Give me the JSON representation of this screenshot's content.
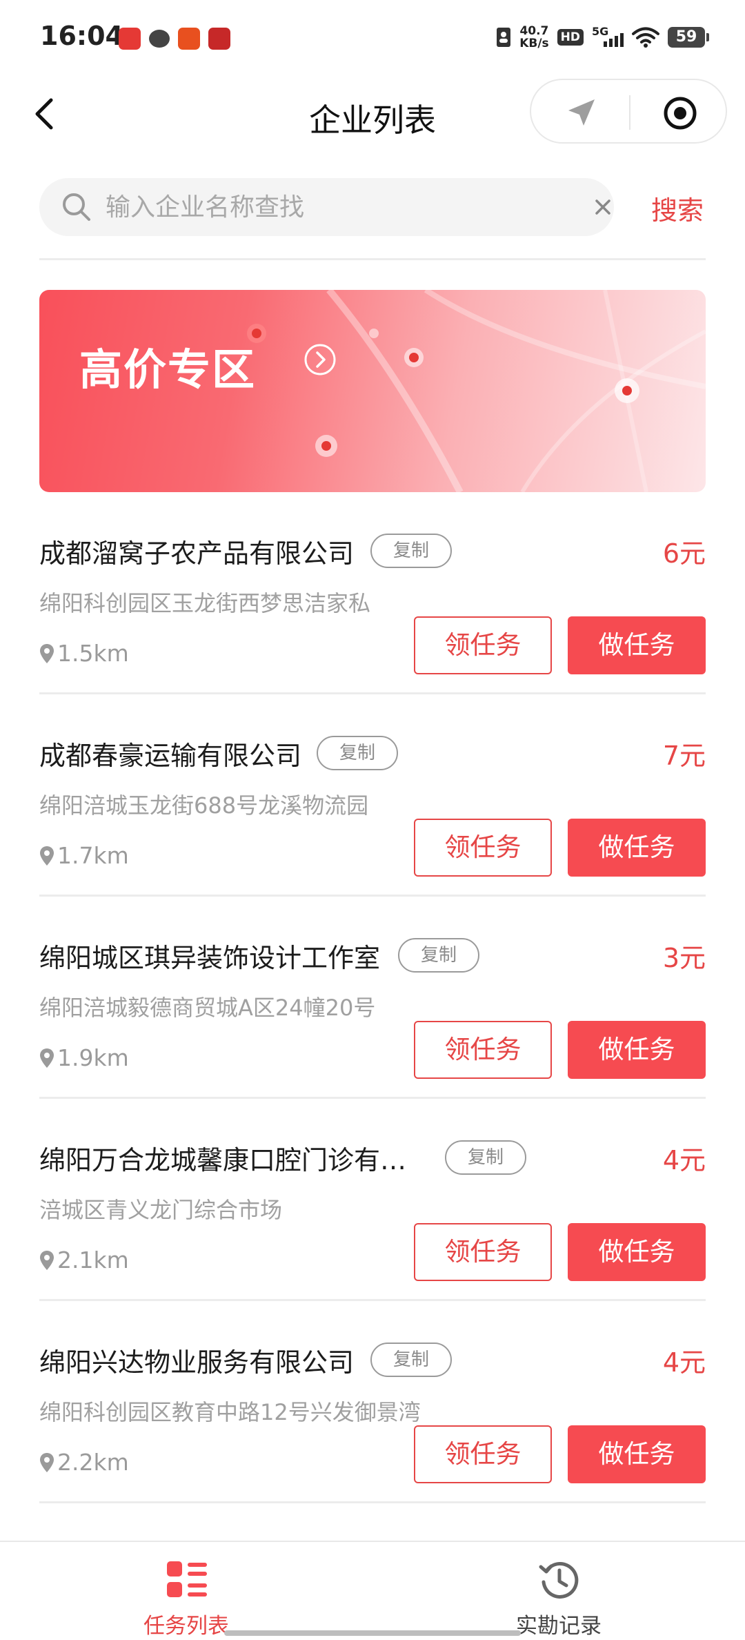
{
  "status_bar": {
    "time": "16:04",
    "net_speed_value": "40.7",
    "net_speed_unit": "KB/s",
    "hd": "HD",
    "network": "5G",
    "battery": "59"
  },
  "nav": {
    "title": "企业列表",
    "back_icon": "chevron-left-icon",
    "capsule_icons": [
      "location-arrow-icon",
      "target-icon"
    ]
  },
  "search": {
    "placeholder": "输入企业名称查找",
    "value": "",
    "button_label": "搜索"
  },
  "banner": {
    "title": "高价专区"
  },
  "companies": [
    {
      "name": "成都溜窝子农产品有限公司",
      "copy_label": "复制",
      "price": "6元",
      "address": "绵阳科创园区玉龙街西梦思洁家私",
      "distance": "1.5km",
      "claim_label": "领任务",
      "do_label": "做任务"
    },
    {
      "name": "成都春豪运输有限公司",
      "copy_label": "复制",
      "price": "7元",
      "address": "绵阳涪城玉龙街688号龙溪物流园",
      "distance": "1.7km",
      "claim_label": "领任务",
      "do_label": "做任务"
    },
    {
      "name": "绵阳城区琪异装饰设计工作室",
      "copy_label": "复制",
      "price": "3元",
      "address": "绵阳涪城毅德商贸城A区24幢20号",
      "distance": "1.9km",
      "claim_label": "领任务",
      "do_label": "做任务"
    },
    {
      "name": "绵阳万合龙城馨康口腔门诊有…",
      "copy_label": "复制",
      "price": "4元",
      "address": "涪城区青义龙门综合市场",
      "distance": "2.1km",
      "claim_label": "领任务",
      "do_label": "做任务"
    },
    {
      "name": "绵阳兴达物业服务有限公司",
      "copy_label": "复制",
      "price": "4元",
      "address": "绵阳科创园区教育中路12号兴发御景湾",
      "distance": "2.2km",
      "claim_label": "领任务",
      "do_label": "做任务"
    }
  ],
  "tab_bar": {
    "tabs": [
      {
        "label": "任务列表",
        "icon": "task-list-icon",
        "active": true
      },
      {
        "label": "实勘记录",
        "icon": "history-clock-icon",
        "active": false
      }
    ]
  },
  "colors": {
    "accent": "#e64646",
    "button_fill": "#f64b51",
    "muted_text": "#a0a0a0"
  }
}
